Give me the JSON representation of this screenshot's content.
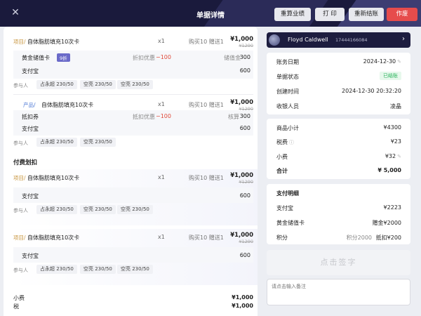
{
  "header": {
    "title": "单据详情",
    "buttons": {
      "recalc": "重算业绩",
      "print": "打 印",
      "resettle": "重新结账",
      "void": "作废"
    }
  },
  "left": {
    "items": [
      {
        "category": "项目/",
        "name": "自体脂肪填充10次卡",
        "qty": "x1",
        "promo": "购买10 赠送1",
        "price": "¥1,000",
        "orig_price": "¥1290",
        "payments": [
          {
            "label": "黄金储值卡",
            "tag": "9折",
            "detail_label": "折扣优惠",
            "detail_value": "−100",
            "extra_label": "储值金",
            "extra_value": "300"
          },
          {
            "label": "支付宝",
            "value": "600"
          }
        ],
        "staff_label": "参与人",
        "staff": [
          "占永超 230/50",
          "空亮 230/50",
          "空亮 230/50"
        ]
      },
      {
        "category": "产品/",
        "name": "自体脂肪填充10次卡",
        "qty": "x1",
        "promo": "购买10 赠送1",
        "price": "¥1,000",
        "orig_price": "¥1290",
        "payments": [
          {
            "label": "抵扣券",
            "detail_label": "抵扣优惠",
            "detail_value": "−100",
            "extra_label": "核算",
            "extra_value": "300"
          },
          {
            "label": "支付宝",
            "value": "600"
          }
        ],
        "staff_label": "参与人",
        "staff": [
          "占永超 230/50",
          "空亮 230/50"
        ]
      }
    ],
    "deduct_title": "付费划扣",
    "deduct_items": [
      {
        "category": "项目/",
        "name": "自体脂肪填充10次卡",
        "qty": "x1",
        "promo": "购买10 赠送1",
        "price": "¥1,000",
        "orig_price": "¥1290",
        "pay_label": "支付宝",
        "pay_value": "600",
        "staff_label": "参与人",
        "staff": [
          "占永超 230/50",
          "空亮 230/50",
          "空亮 230/50"
        ]
      },
      {
        "category": "项目/",
        "name": "自体脂肪填充10次卡",
        "qty": "x1",
        "promo": "购买10 赠送1",
        "price": "¥1,000",
        "orig_price": "¥1290",
        "pay_label": "支付宝",
        "pay_value": "600",
        "staff_label": "参与人",
        "staff": [
          "占永超 230/50",
          "空亮 230/50",
          "空亮 230/50"
        ]
      }
    ],
    "totals": [
      {
        "label": "小费",
        "value": "¥1,000"
      },
      {
        "label": "税",
        "value": "¥1,000"
      }
    ]
  },
  "right": {
    "user": {
      "name": "Floyd Caldwell",
      "phone": "17444166084"
    },
    "info": [
      {
        "label": "账务日期",
        "value": "2024-12-30"
      },
      {
        "label": "单据状态",
        "value": "已结账"
      },
      {
        "label": "创建时间",
        "value": "2024-12-30 20:32:20"
      },
      {
        "label": "收银人员",
        "value": "凌晶"
      }
    ],
    "summary": [
      {
        "label": "商品小计",
        "value": "¥4300"
      },
      {
        "label": "税费",
        "value": "¥23"
      },
      {
        "label": "小费",
        "value": "¥32"
      },
      {
        "label": "合计",
        "value": "¥ 5,000"
      }
    ],
    "payment_title": "支付明细",
    "payment_rows": [
      {
        "label": "支付宝",
        "value": "¥2223"
      },
      {
        "label": "黄金储值卡",
        "value": "赠金¥2000"
      },
      {
        "label": "积分",
        "sub": "积分2000",
        "value": "抵扣¥200"
      }
    ],
    "sign_placeholder": "点击签字",
    "note_placeholder": "请点击输入备注"
  },
  "colors": {
    "header_bg": "#1a1a3c",
    "void": "#e64c4c",
    "accent_tag": "#6a6ac9",
    "status_green": "#29b35b",
    "discount_red": "#e04a3a",
    "category_gold": "#c8953d",
    "category_blue": "#4f7ad6"
  },
  "icons": {
    "close": "close-icon",
    "arrow": "chevron-right-icon",
    "edit": "pencil-icon",
    "info": "info-icon"
  }
}
